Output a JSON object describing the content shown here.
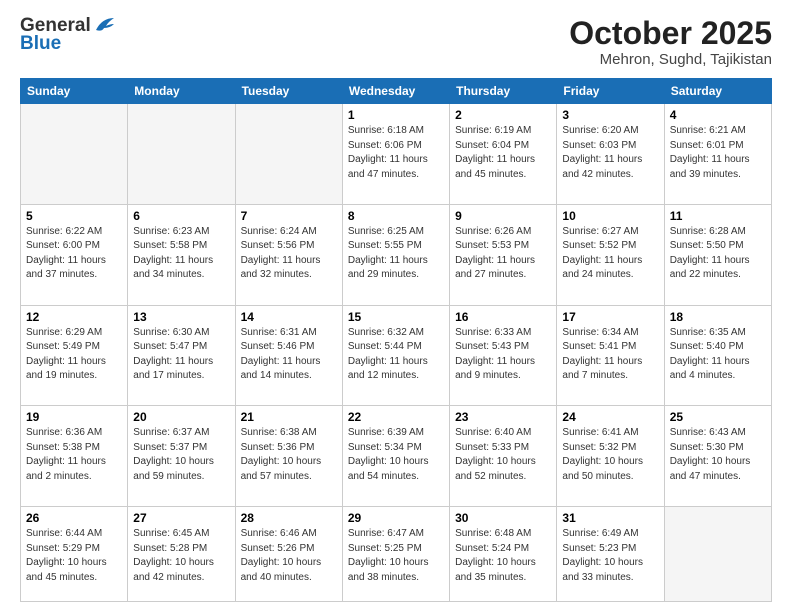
{
  "logo": {
    "general": "General",
    "blue": "Blue"
  },
  "header": {
    "month": "October 2025",
    "location": "Mehron, Sughd, Tajikistan"
  },
  "days_of_week": [
    "Sunday",
    "Monday",
    "Tuesday",
    "Wednesday",
    "Thursday",
    "Friday",
    "Saturday"
  ],
  "weeks": [
    [
      {
        "day": "",
        "detail": ""
      },
      {
        "day": "",
        "detail": ""
      },
      {
        "day": "",
        "detail": ""
      },
      {
        "day": "1",
        "detail": "Sunrise: 6:18 AM\nSunset: 6:06 PM\nDaylight: 11 hours\nand 47 minutes."
      },
      {
        "day": "2",
        "detail": "Sunrise: 6:19 AM\nSunset: 6:04 PM\nDaylight: 11 hours\nand 45 minutes."
      },
      {
        "day": "3",
        "detail": "Sunrise: 6:20 AM\nSunset: 6:03 PM\nDaylight: 11 hours\nand 42 minutes."
      },
      {
        "day": "4",
        "detail": "Sunrise: 6:21 AM\nSunset: 6:01 PM\nDaylight: 11 hours\nand 39 minutes."
      }
    ],
    [
      {
        "day": "5",
        "detail": "Sunrise: 6:22 AM\nSunset: 6:00 PM\nDaylight: 11 hours\nand 37 minutes."
      },
      {
        "day": "6",
        "detail": "Sunrise: 6:23 AM\nSunset: 5:58 PM\nDaylight: 11 hours\nand 34 minutes."
      },
      {
        "day": "7",
        "detail": "Sunrise: 6:24 AM\nSunset: 5:56 PM\nDaylight: 11 hours\nand 32 minutes."
      },
      {
        "day": "8",
        "detail": "Sunrise: 6:25 AM\nSunset: 5:55 PM\nDaylight: 11 hours\nand 29 minutes."
      },
      {
        "day": "9",
        "detail": "Sunrise: 6:26 AM\nSunset: 5:53 PM\nDaylight: 11 hours\nand 27 minutes."
      },
      {
        "day": "10",
        "detail": "Sunrise: 6:27 AM\nSunset: 5:52 PM\nDaylight: 11 hours\nand 24 minutes."
      },
      {
        "day": "11",
        "detail": "Sunrise: 6:28 AM\nSunset: 5:50 PM\nDaylight: 11 hours\nand 22 minutes."
      }
    ],
    [
      {
        "day": "12",
        "detail": "Sunrise: 6:29 AM\nSunset: 5:49 PM\nDaylight: 11 hours\nand 19 minutes."
      },
      {
        "day": "13",
        "detail": "Sunrise: 6:30 AM\nSunset: 5:47 PM\nDaylight: 11 hours\nand 17 minutes."
      },
      {
        "day": "14",
        "detail": "Sunrise: 6:31 AM\nSunset: 5:46 PM\nDaylight: 11 hours\nand 14 minutes."
      },
      {
        "day": "15",
        "detail": "Sunrise: 6:32 AM\nSunset: 5:44 PM\nDaylight: 11 hours\nand 12 minutes."
      },
      {
        "day": "16",
        "detail": "Sunrise: 6:33 AM\nSunset: 5:43 PM\nDaylight: 11 hours\nand 9 minutes."
      },
      {
        "day": "17",
        "detail": "Sunrise: 6:34 AM\nSunset: 5:41 PM\nDaylight: 11 hours\nand 7 minutes."
      },
      {
        "day": "18",
        "detail": "Sunrise: 6:35 AM\nSunset: 5:40 PM\nDaylight: 11 hours\nand 4 minutes."
      }
    ],
    [
      {
        "day": "19",
        "detail": "Sunrise: 6:36 AM\nSunset: 5:38 PM\nDaylight: 11 hours\nand 2 minutes."
      },
      {
        "day": "20",
        "detail": "Sunrise: 6:37 AM\nSunset: 5:37 PM\nDaylight: 10 hours\nand 59 minutes."
      },
      {
        "day": "21",
        "detail": "Sunrise: 6:38 AM\nSunset: 5:36 PM\nDaylight: 10 hours\nand 57 minutes."
      },
      {
        "day": "22",
        "detail": "Sunrise: 6:39 AM\nSunset: 5:34 PM\nDaylight: 10 hours\nand 54 minutes."
      },
      {
        "day": "23",
        "detail": "Sunrise: 6:40 AM\nSunset: 5:33 PM\nDaylight: 10 hours\nand 52 minutes."
      },
      {
        "day": "24",
        "detail": "Sunrise: 6:41 AM\nSunset: 5:32 PM\nDaylight: 10 hours\nand 50 minutes."
      },
      {
        "day": "25",
        "detail": "Sunrise: 6:43 AM\nSunset: 5:30 PM\nDaylight: 10 hours\nand 47 minutes."
      }
    ],
    [
      {
        "day": "26",
        "detail": "Sunrise: 6:44 AM\nSunset: 5:29 PM\nDaylight: 10 hours\nand 45 minutes."
      },
      {
        "day": "27",
        "detail": "Sunrise: 6:45 AM\nSunset: 5:28 PM\nDaylight: 10 hours\nand 42 minutes."
      },
      {
        "day": "28",
        "detail": "Sunrise: 6:46 AM\nSunset: 5:26 PM\nDaylight: 10 hours\nand 40 minutes."
      },
      {
        "day": "29",
        "detail": "Sunrise: 6:47 AM\nSunset: 5:25 PM\nDaylight: 10 hours\nand 38 minutes."
      },
      {
        "day": "30",
        "detail": "Sunrise: 6:48 AM\nSunset: 5:24 PM\nDaylight: 10 hours\nand 35 minutes."
      },
      {
        "day": "31",
        "detail": "Sunrise: 6:49 AM\nSunset: 5:23 PM\nDaylight: 10 hours\nand 33 minutes."
      },
      {
        "day": "",
        "detail": ""
      }
    ]
  ]
}
